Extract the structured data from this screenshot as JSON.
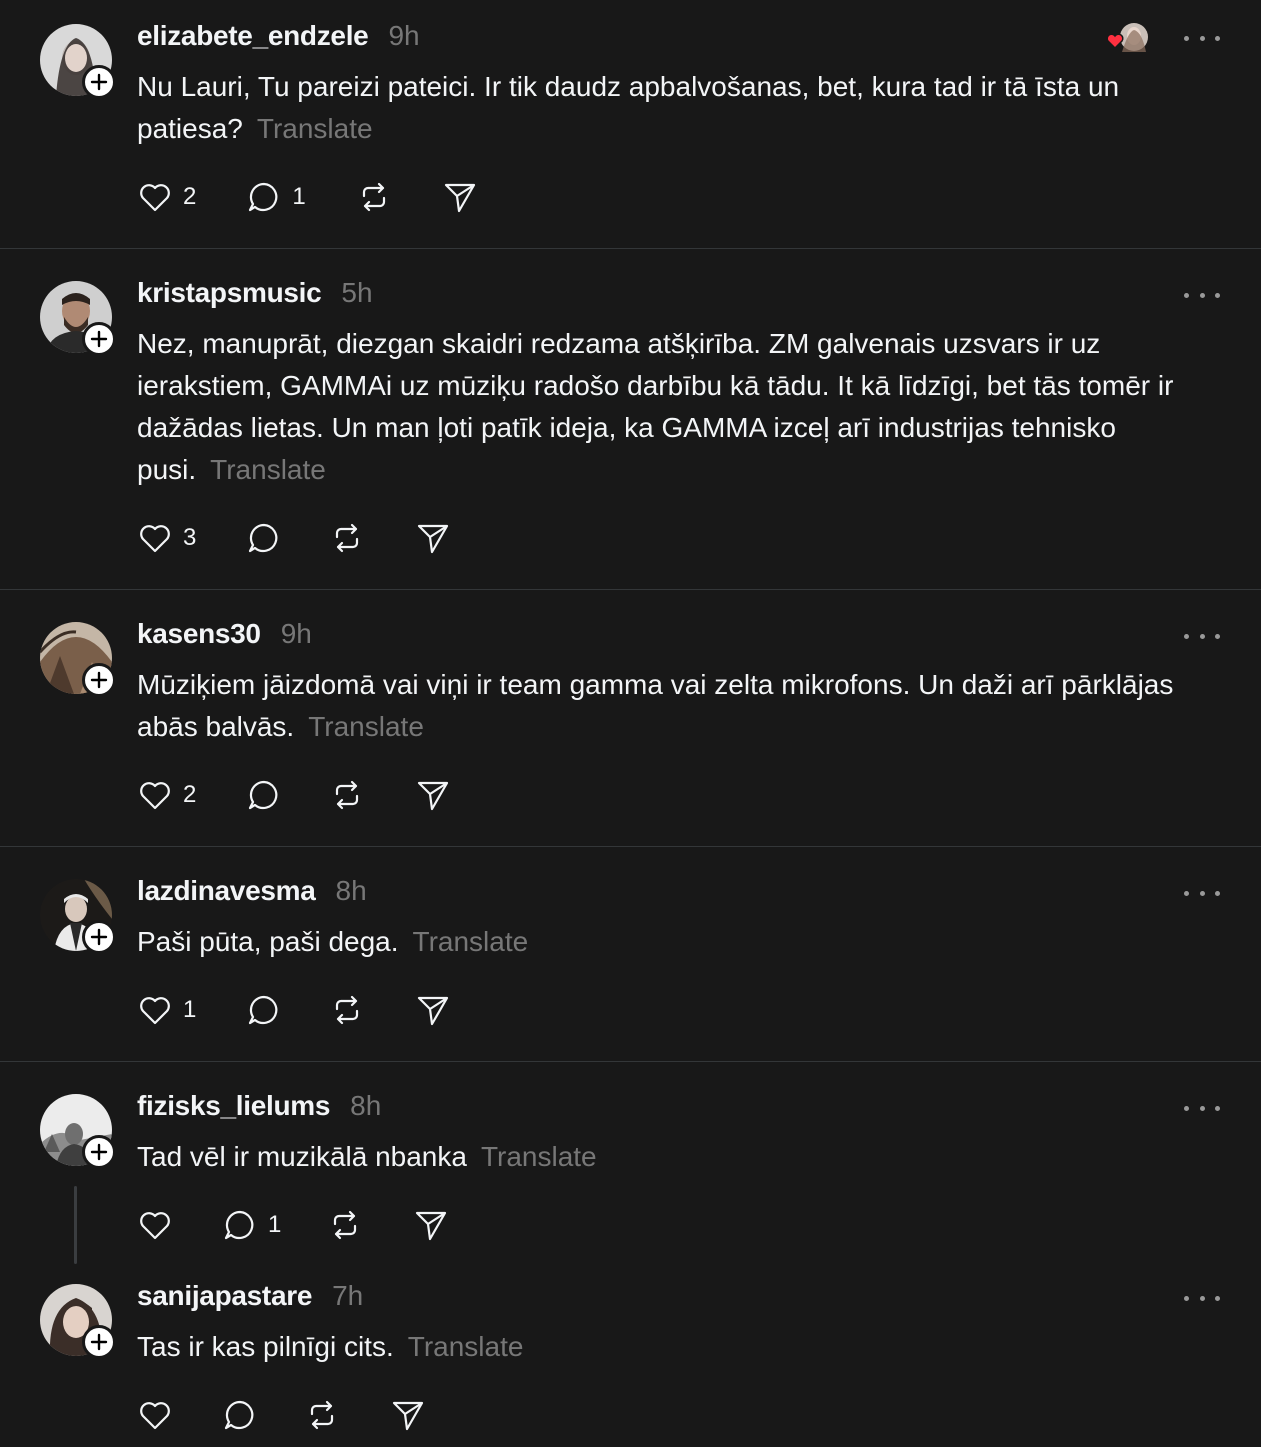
{
  "posts": [
    {
      "username": "elizabete_endzele",
      "time": "9h",
      "text": "Nu Lauri, Tu pareizi pateici. Ir tik daudz apbalvošanas, bet, kura tad ir tā īsta un patiesa?",
      "translate": "Translate",
      "likes": "2",
      "replies": "1",
      "liked_by_author": true
    },
    {
      "username": "kristapsmusic",
      "time": "5h",
      "text": "Nez, manuprāt, diezgan skaidri redzama atšķirība. ZM galvenais uzsvars ir uz ierakstiem, GAMMAi uz mūziķu radošo darbību kā tādu. It kā līdzīgi, bet tās tomēr ir dažādas lietas. Un man ļoti patīk ideja, ka GAMMA izceļ arī industrijas tehnisko pusi.",
      "translate": "Translate",
      "likes": "3",
      "replies": ""
    },
    {
      "username": "kasens30",
      "time": "9h",
      "text": "Mūziķiem jāizdomā vai viņi ir team gamma vai zelta mikrofons. Un daži arī pārklājas abās balvās.",
      "translate": "Translate",
      "likes": "2",
      "replies": ""
    },
    {
      "username": "lazdinavesma",
      "time": "8h",
      "text": "Paši pūta, paši dega.",
      "translate": "Translate",
      "likes": "1",
      "replies": ""
    },
    {
      "username": "fizisks_lielums",
      "time": "8h",
      "text": "Tad vēl ir muzikālā nbanka",
      "translate": "Translate",
      "likes": "",
      "replies": "1"
    },
    {
      "username": "sanijapastare",
      "time": "7h",
      "text": "Tas ir kas pilnīgi cits.",
      "translate": "Translate",
      "likes": "",
      "replies": ""
    }
  ],
  "icons": {
    "like": "heart-icon",
    "reply": "comment-icon",
    "repost": "repost-icon",
    "share": "send-icon",
    "more": "more-icon",
    "follow": "plus-icon"
  },
  "colors": {
    "background": "#181818",
    "text": "#f3f5f7",
    "muted": "#777777",
    "divider": "#333638",
    "like_red": "#ff3040"
  }
}
